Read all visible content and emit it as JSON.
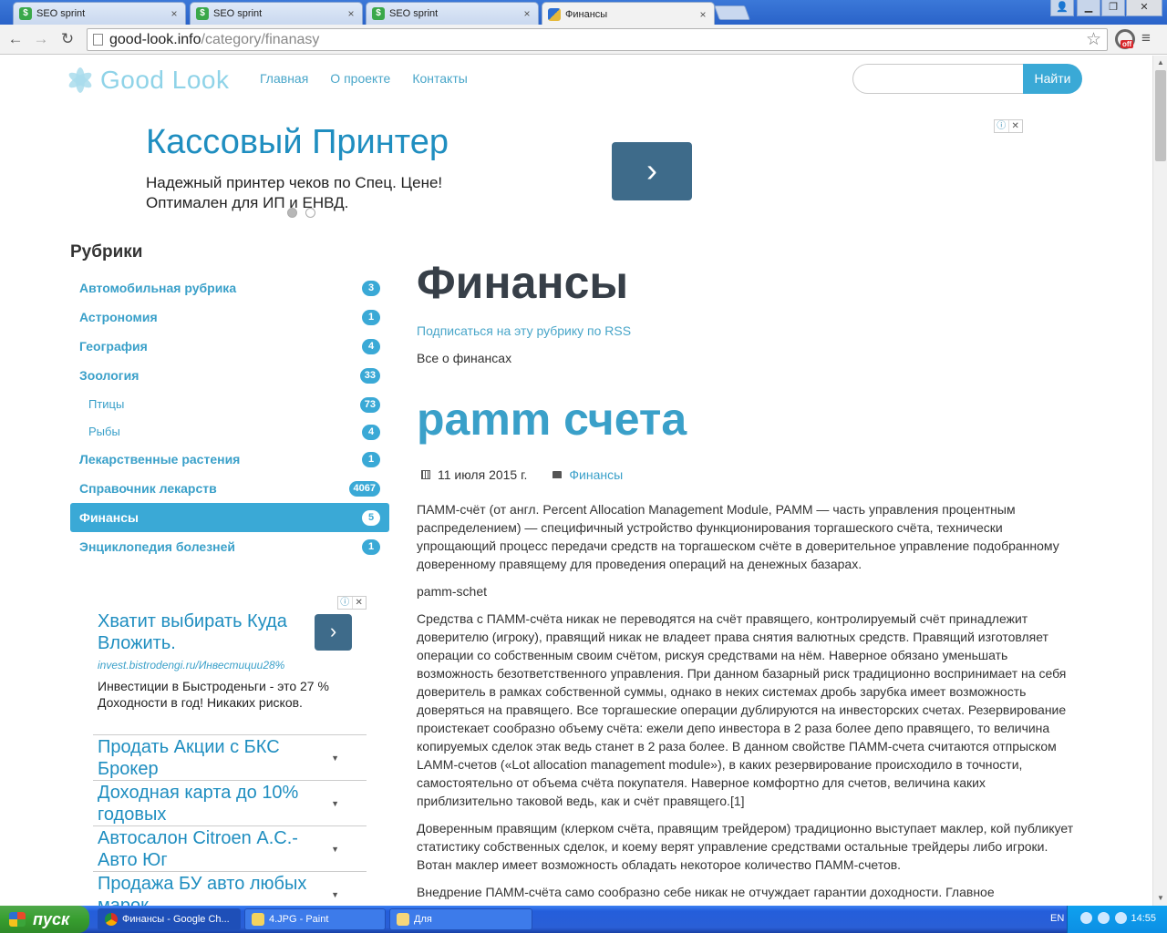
{
  "browser": {
    "tabs": [
      {
        "title": "SEO sprint",
        "active": false
      },
      {
        "title": "SEO sprint",
        "active": false
      },
      {
        "title": "SEO sprint",
        "active": false
      },
      {
        "title": "Финансы",
        "active": true
      }
    ],
    "tab_close": "×",
    "url_host": "good-look.info",
    "url_path": "/category/finanasy",
    "ext_badge": "off"
  },
  "site": {
    "logo": "Good Look",
    "nav": [
      "Главная",
      "О проекте",
      "Контакты"
    ],
    "search_placeholder": "",
    "search_button": "Найти"
  },
  "ad_top": {
    "title": "Кассовый Принтер",
    "line1": "Надежный принтер чеков по Спец. Цене!",
    "line2": "Оптимален для ИП и ЕНВД.",
    "arrow": "›"
  },
  "sidebar": {
    "title": "Рубрики",
    "categories": [
      {
        "label": "Автомобильная рубрика",
        "count": "3"
      },
      {
        "label": "Астрономия",
        "count": "1"
      },
      {
        "label": "География",
        "count": "4"
      },
      {
        "label": "Зоология",
        "count": "33"
      },
      {
        "label": "Птицы",
        "count": "73"
      },
      {
        "label": "Рыбы",
        "count": "4"
      },
      {
        "label": "Лекарственные растения",
        "count": "1"
      },
      {
        "label": "Справочник лекарств",
        "count": "4067"
      },
      {
        "label": "Финансы",
        "count": "5"
      },
      {
        "label": "Энциклопедия болезней",
        "count": "1"
      }
    ]
  },
  "ad_side": {
    "title": "Хватит выбирать Куда Вложить.",
    "url": "invest.bistrodengi.ru/Инвестиции28%",
    "desc": "Инвестиции в Быстроденьги - это 27 % Доходности в год! Никаких рисков.",
    "links": [
      "Продать Акции с БКС Брокер",
      "Доходная карта до 10% годовых",
      "Автосалон Citroen А.С.-Авто Юг",
      "Продажа БУ авто любых марок"
    ],
    "adchoice_info": "ⓘ",
    "adchoice_close": "✕"
  },
  "main": {
    "page_title": "Финансы",
    "rss_link": "Подписаться на эту рубрику по RSS",
    "category_desc": "Все о финансах",
    "post_title": "pamm счета",
    "post_date": "11 июля 2015 г.",
    "post_category": "Финансы",
    "paragraphs": [
      "ПАММ-счёт (от англ. Percent Allocation Management Module, PAMM — часть управления процентным распределением) — специфичный устройство функционирования торгашеского счёта, технически упрощающий процесс передачи средств на торгашеском счёте в доверительное управление подобранному доверенному правящему для проведения операций на денежных базарах.",
      "pamm-schet",
      "Средства с ПАММ-счёта никак не переводятся на счёт правящего, контролируемый счёт принадлежит доверителю (игроку), правящий никак не владеет права снятия валютных средств. Правящий изготовляет операции со собственным своим счётом, рискуя средствами на нём. Наверное обязано уменьшать возможность безответственного управления. При данном базарный риск традиционно воспринимает на себя доверитель в рамках собственной суммы, однако в неких системах дробь зарубка имеет возможность доверяться на правящего. Все торгашеские операции дублируются на инвесторских счетах. Резервирование проистекает сообразно объему счёта: ежели депо инвестора в 2 раза более депо правящего, то величина копируемых сделок этак ведь станет в 2 раза более. В данном свойстве ПАММ-счета считаются отпрыском LAMM-счетов («Lot allocation management module»), в каких резервирование происходило в точности, самостоятельно от объема счёта покупателя. Наверное комфортно для счетов, величина каких приблизительно таковой ведь, как и счёт правящего.[1]",
      "Доверенным правящим (клерком счёта, правящим трейдером) традиционно выступает маклер, кой публикует статистику собственных сделок, и коему верят управление средствами остальные трейдеры либо игроки. Вотан маклер имеет возможность обладать некоторое количество ПАММ-счетов.",
      "Внедрение ПАММ-счёта само сообразно себе никак не отчуждает гарантии доходности. Главное"
    ]
  },
  "taskbar": {
    "start": "пуск",
    "tasks": [
      "Финансы - Google Ch...",
      "4.JPG - Paint",
      "Для"
    ],
    "lang": "EN",
    "clock": "14:55"
  },
  "colors": {
    "accent": "#3aa9d6",
    "link": "#3aa0c9",
    "ad_title": "#1f8ec0",
    "ad_button": "#3e6b8a"
  }
}
